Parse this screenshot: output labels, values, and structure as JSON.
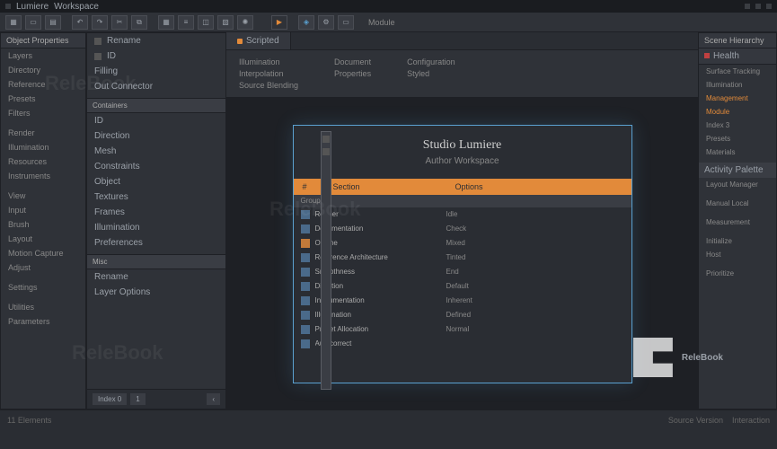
{
  "titlebar": {
    "app": "Lumiere",
    "doc": "Workspace"
  },
  "toolbar": {
    "label": "Module"
  },
  "left": {
    "header": "Object Properties",
    "items": [
      "Layers",
      "Directory",
      "Reference",
      "Presets",
      "Filters",
      "",
      "Render",
      "Illumination",
      "Resources",
      "Instruments",
      "",
      "View",
      "Input",
      "Brush",
      "Layout",
      "Motion Capture",
      "Adjust",
      "",
      "Settings",
      "",
      "Utilities",
      "Parameters"
    ]
  },
  "mid": {
    "header": "",
    "groups": [
      {
        "title": "",
        "items": [
          {
            "ic": true,
            "t": "Rename"
          },
          {
            "ic": true,
            "t": "ID"
          },
          {
            "ic": false,
            "t": "Filling"
          },
          {
            "ic": false,
            "t": "Out Connector"
          }
        ]
      },
      {
        "title": "Containers",
        "items": [
          {
            "ic": false,
            "t": "ID"
          },
          {
            "ic": false,
            "t": "Direction"
          },
          {
            "ic": false,
            "t": "Mesh"
          },
          {
            "ic": false,
            "t": "Constraints"
          },
          {
            "ic": false,
            "t": "Object"
          },
          {
            "ic": false,
            "t": "Textures"
          },
          {
            "ic": false,
            "t": "Frames"
          },
          {
            "ic": false,
            "t": "Illumination"
          },
          {
            "ic": false,
            "t": "Preferences"
          }
        ]
      },
      {
        "title": "Misc",
        "items": [
          {
            "ic": false,
            "t": "Rename"
          },
          {
            "ic": false,
            "t": "Layer Options"
          }
        ]
      }
    ],
    "footer": [
      "Index 0",
      "1"
    ]
  },
  "center": {
    "tab": "Scripted",
    "info": [
      [
        "Illumination",
        "Interpolation",
        "Source Blending"
      ],
      [
        "Document",
        "Properties"
      ],
      [
        "Configuration",
        "Styled"
      ]
    ],
    "dialog": {
      "title": "Studio Lumiere",
      "subtitle": "Author Workspace",
      "headers": [
        "#",
        "Id Section",
        "Options"
      ],
      "subheader": "Group",
      "rows": [
        {
          "ic": "b",
          "name": "Render",
          "val": "Idle"
        },
        {
          "ic": "b",
          "name": "Documentation",
          "val": "Check"
        },
        {
          "ic": "or",
          "name": "Outline",
          "val": "Mixed"
        },
        {
          "ic": "b",
          "name": "Reference Architecture",
          "val": "Tinted"
        },
        {
          "ic": "b",
          "name": "Smoothness",
          "val": "End"
        },
        {
          "ic": "b",
          "name": "Direction",
          "val": "Default"
        },
        {
          "ic": "b",
          "name": "Instrumentation",
          "val": "Inherent"
        },
        {
          "ic": "b",
          "name": "Illumination",
          "val": "Defined"
        },
        {
          "ic": "b",
          "name": "Preset Allocation",
          "val": "Normal"
        },
        {
          "ic": "b",
          "name": "Autocorrect",
          "val": ""
        }
      ]
    }
  },
  "right": {
    "header": "Scene Hierarchy",
    "sections": [
      {
        "head": "Health",
        "items": [
          "Surface Tracking",
          "Illumination"
        ]
      },
      {
        "head": "",
        "items": [
          {
            "t": "Management",
            "or": true
          },
          {
            "t": "Module",
            "or": true
          }
        ]
      },
      {
        "head": "",
        "items": [
          "Index 3",
          "Presets",
          "Materials"
        ]
      },
      {
        "head": "Activity Palette",
        "items": [
          "Layout Manager",
          "",
          "Manual Local"
        ]
      },
      {
        "head": "",
        "items": [
          "",
          "Measurement",
          "",
          "Initialize"
        ]
      },
      {
        "head": "",
        "items": [
          "Host",
          ""
        ]
      },
      {
        "head": "",
        "items": [
          "Prioritize"
        ]
      }
    ]
  },
  "bottom": {
    "left": "11 Elements",
    "right": "Source Version",
    "rr": "Interaction"
  },
  "watermark": "ReleBook"
}
